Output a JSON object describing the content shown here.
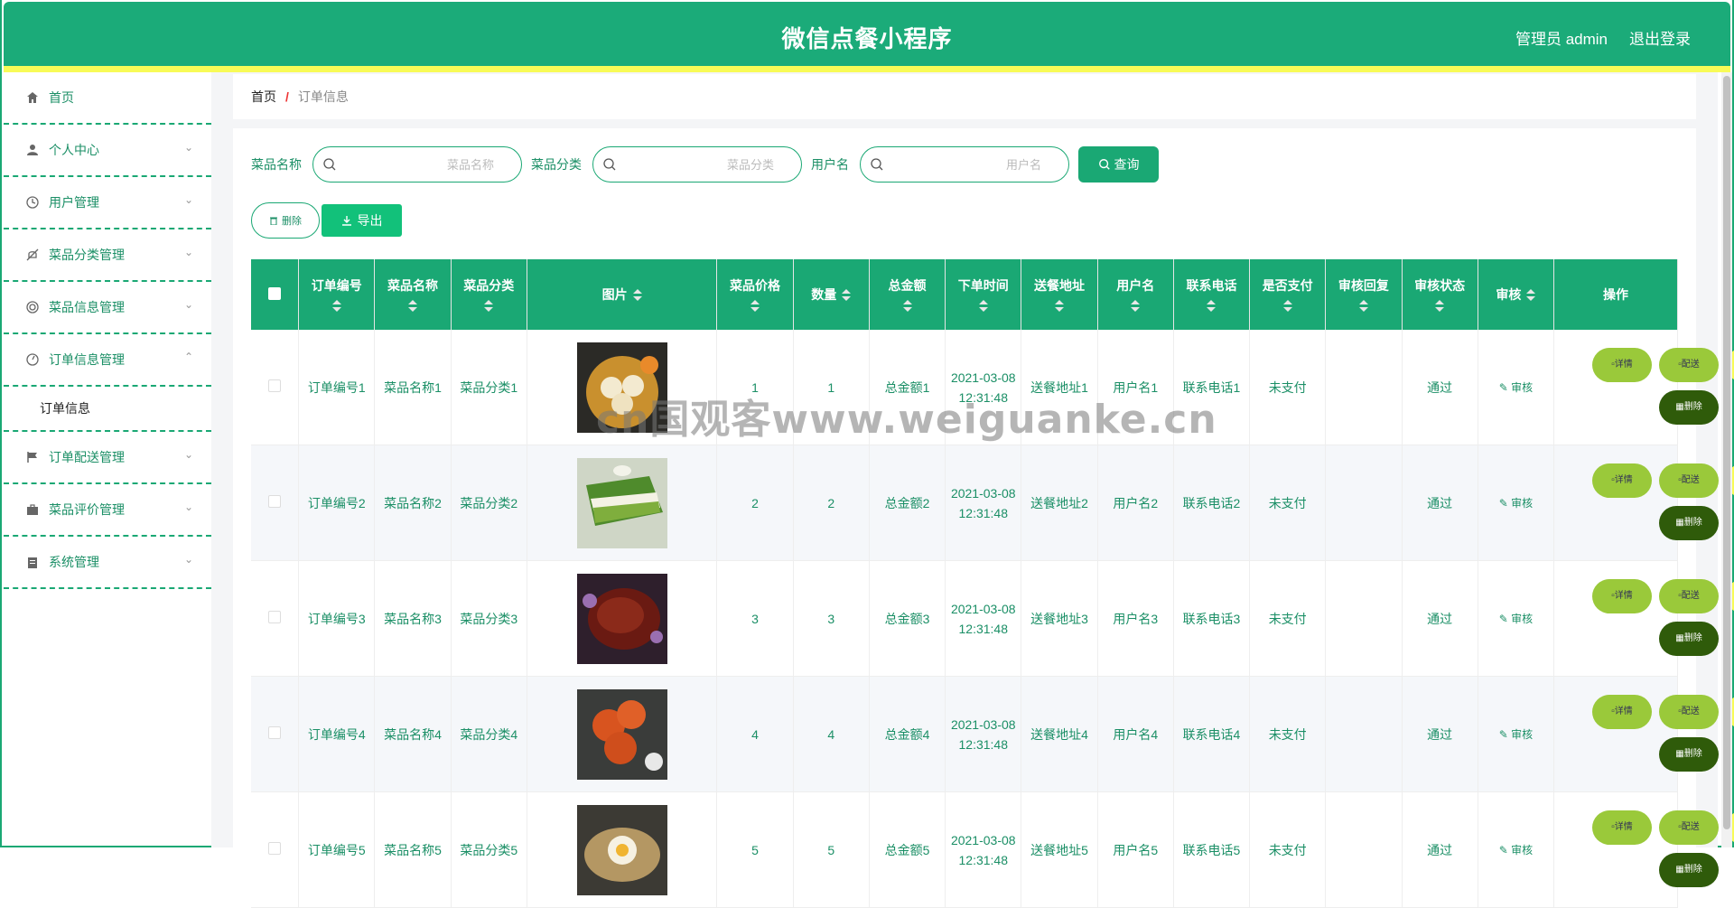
{
  "header": {
    "title": "微信点餐小程序",
    "user": "管理员 admin",
    "logout": "退出登录"
  },
  "sidebar": {
    "items": [
      {
        "label": "首页",
        "icon": "home-icon"
      },
      {
        "label": "个人中心",
        "icon": "user-icon"
      },
      {
        "label": "用户管理",
        "icon": "clock-icon"
      },
      {
        "label": "菜品分类管理",
        "icon": "bell-off-icon"
      },
      {
        "label": "菜品信息管理",
        "icon": "ring-icon"
      },
      {
        "label": "订单信息管理",
        "icon": "gauge-icon"
      },
      {
        "label": "订单配送管理",
        "icon": "flag-icon"
      },
      {
        "label": "菜品评价管理",
        "icon": "briefcase-icon"
      },
      {
        "label": "系统管理",
        "icon": "clipboard-icon"
      }
    ],
    "submenu_label": "订单信息"
  },
  "breadcrumb": {
    "home": "首页",
    "sep": "/",
    "current": "订单信息"
  },
  "search": {
    "dish_name_label": "菜品名称",
    "dish_name_placeholder": "菜品名称",
    "dish_category_label": "菜品分类",
    "dish_category_placeholder": "菜品分类",
    "username_label": "用户名",
    "username_placeholder": "用户名",
    "query_label": "查询"
  },
  "actions": {
    "delete_label": "删除",
    "export_label": "导出"
  },
  "table": {
    "columns": [
      "订单编号",
      "菜品名称",
      "菜品分类",
      "图片",
      "菜品价格",
      "数量",
      "总金额",
      "下单时间",
      "送餐地址",
      "用户名",
      "联系电话",
      "是否支付",
      "审核回复",
      "审核状态",
      "审核",
      "操作"
    ],
    "rows": [
      {
        "order_no": "订单编号1",
        "dish": "菜品名称1",
        "category": "菜品分类1",
        "price": "1",
        "qty": "1",
        "total": "总金额1",
        "time": "2021-03-08 12:31:48",
        "address": "送餐地址1",
        "user": "用户名1",
        "phone": "联系电话1",
        "paid": "未支付",
        "reply": "",
        "status": "通过",
        "image": "dumplings-photo"
      },
      {
        "order_no": "订单编号2",
        "dish": "菜品名称2",
        "category": "菜品分类2",
        "price": "2",
        "qty": "2",
        "total": "总金额2",
        "time": "2021-03-08 12:31:48",
        "address": "送餐地址2",
        "user": "用户名2",
        "phone": "联系电话2",
        "paid": "未支付",
        "reply": "",
        "status": "通过",
        "image": "matcha-cake-photo"
      },
      {
        "order_no": "订单编号3",
        "dish": "菜品名称3",
        "category": "菜品分类3",
        "price": "3",
        "qty": "3",
        "total": "总金额3",
        "time": "2021-03-08 12:31:48",
        "address": "送餐地址3",
        "user": "用户名3",
        "phone": "联系电话3",
        "paid": "未支付",
        "reply": "",
        "status": "通过",
        "image": "braised-meat-photo"
      },
      {
        "order_no": "订单编号4",
        "dish": "菜品名称4",
        "category": "菜品分类4",
        "price": "4",
        "qty": "4",
        "total": "总金额4",
        "time": "2021-03-08 12:31:48",
        "address": "送餐地址4",
        "user": "用户名4",
        "phone": "联系电话4",
        "paid": "未支付",
        "reply": "",
        "status": "通过",
        "image": "crab-photo"
      },
      {
        "order_no": "订单编号5",
        "dish": "菜品名称5",
        "category": "菜品分类5",
        "price": "5",
        "qty": "5",
        "total": "总金额5",
        "time": "2021-03-08 12:31:48",
        "address": "送餐地址5",
        "user": "用户名5",
        "phone": "联系电话5",
        "paid": "未支付",
        "reply": "",
        "status": "通过",
        "image": "egg-dish-photo"
      }
    ],
    "audit_label": "审核",
    "op_detail": "详情",
    "op_deliver": "配送",
    "op_delete": "删除"
  },
  "watermark": "cn国观客www.weiguanke.cn",
  "colors": {
    "primary": "#1aa874",
    "accent_yellow": "#f8fb57",
    "lime": "#9ac93a",
    "dark_green": "#2f5b0a"
  }
}
